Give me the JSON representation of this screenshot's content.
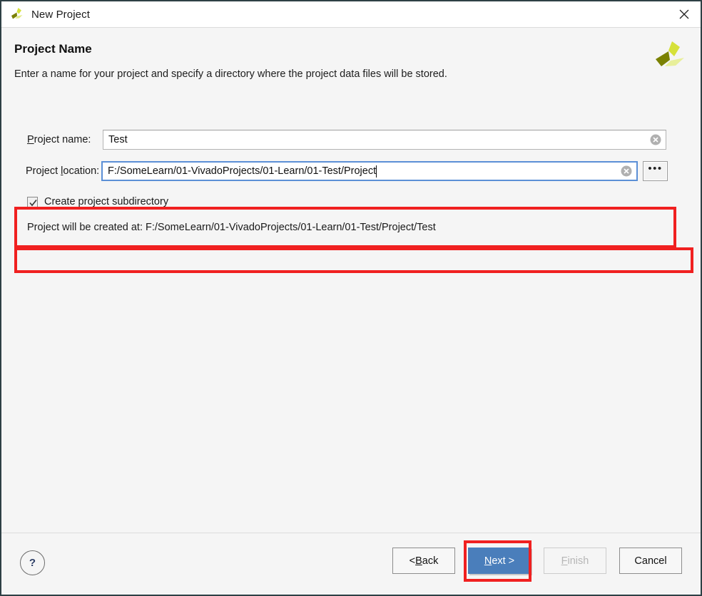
{
  "window": {
    "title": "New Project",
    "logo_icon": "vivado-logo-icon",
    "close_icon": "close-icon"
  },
  "header": {
    "title": "Project Name",
    "subtitle": "Enter a name for your project and specify a directory where the project data files will be stored.",
    "brand_logo_icon": "xilinx-logo-icon"
  },
  "form": {
    "project_name": {
      "label_pre": "",
      "label_mnemonic": "P",
      "label_post": "roject name:",
      "value": "Test",
      "placeholder": "",
      "clear_icon": "clear-circle-icon"
    },
    "project_location": {
      "label_pre": "Project ",
      "label_mnemonic": "l",
      "label_post": "ocation:",
      "value": "F:/SomeLearn/01-VivadoProjects/01-Learn/01-Test/Project",
      "placeholder": "",
      "clear_icon": "clear-circle-icon",
      "browse_label": "•••"
    },
    "create_subdirectory": {
      "label": "Create project subdirectory",
      "checked": true,
      "check_icon": "checkmark-icon"
    },
    "created_at": "Project will be created at: F:/SomeLearn/01-VivadoProjects/01-Learn/01-Test/Project/Test"
  },
  "footer": {
    "help_label": "?",
    "buttons": {
      "back": {
        "pre": "< ",
        "mnemonic": "B",
        "post": "ack"
      },
      "next": {
        "pre": "",
        "mnemonic": "N",
        "post": "ext >"
      },
      "finish": {
        "pre": "",
        "mnemonic": "F",
        "post": "inish"
      },
      "cancel": {
        "pre": "Cancel",
        "mnemonic": "",
        "post": ""
      }
    }
  },
  "colors": {
    "accent_blue": "#4a7ebb",
    "focus_blue": "#5b8fd6",
    "annotation_red": "#f02020",
    "dialog_bg": "#f5f5f5",
    "help_blue": "#2c3e66",
    "logo_green": "#d6e13a",
    "logo_olive": "#7a8100"
  }
}
